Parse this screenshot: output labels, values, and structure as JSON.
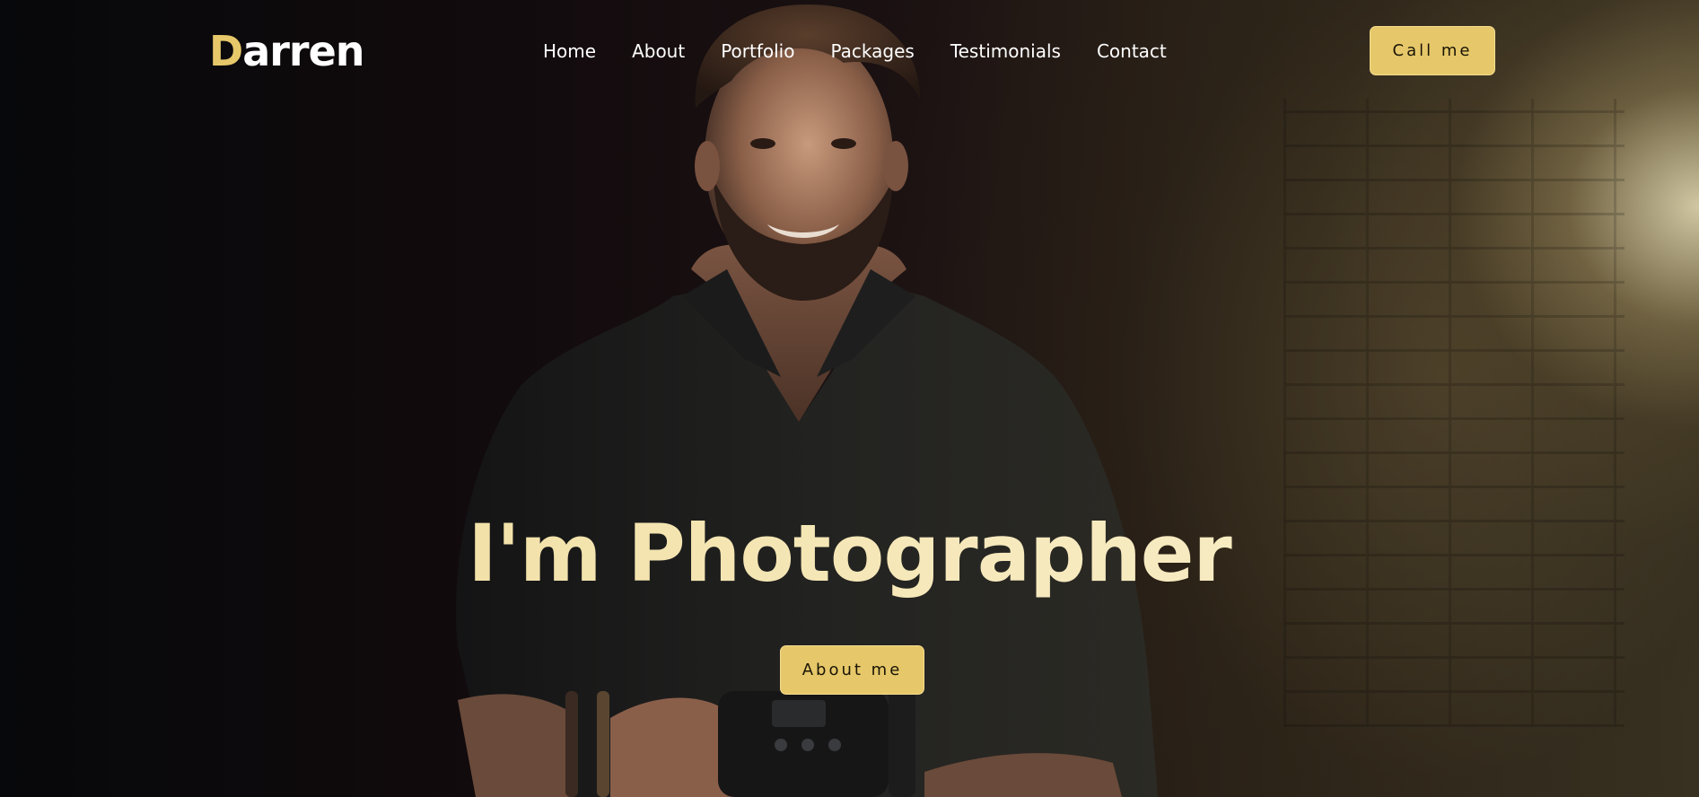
{
  "header": {
    "logo_first_letter": "D",
    "logo_rest": "arren",
    "menu": [
      {
        "label": "Home"
      },
      {
        "label": "About"
      },
      {
        "label": "Portfolio"
      },
      {
        "label": "Packages"
      },
      {
        "label": "Testimonials"
      },
      {
        "label": "Contact"
      }
    ],
    "cta_label": "Call me"
  },
  "hero": {
    "headline": "I'm Photographer",
    "button_label": "About me",
    "background_image": "photographer-holding-camera",
    "accent_color": "#e6c86a",
    "headline_color": "#f2e2a8"
  }
}
